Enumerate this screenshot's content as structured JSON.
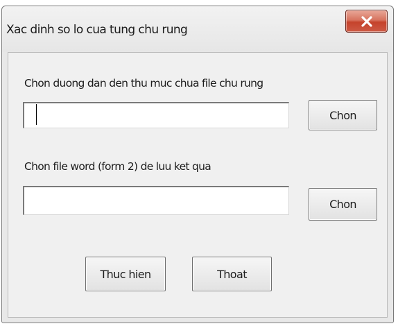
{
  "window": {
    "title": "Xac dinh so lo cua tung chu rung",
    "close_label": "X"
  },
  "folder_section": {
    "label": "Chon duong dan den thu muc chua file chu rung",
    "input_value": "",
    "choose_button": "Chon"
  },
  "word_section": {
    "label": "Chon file word (form 2) de luu ket qua",
    "input_value": "",
    "choose_button": "Chon"
  },
  "actions": {
    "execute_button": "Thuc hien",
    "exit_button": "Thoat"
  },
  "colors": {
    "close_button": "#c5432c",
    "dialog_background": "#f0f0f0"
  },
  "icons": {
    "close": "close-icon"
  }
}
